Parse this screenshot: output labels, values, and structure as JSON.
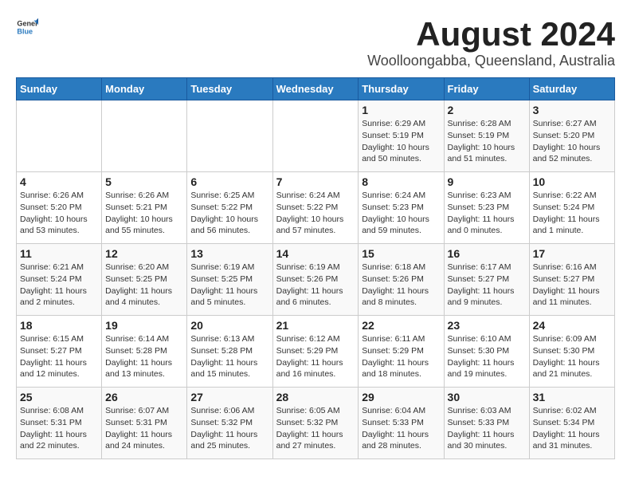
{
  "header": {
    "logo": {
      "general": "General",
      "blue": "Blue"
    },
    "title": "August 2024",
    "subtitle": "Woolloongabba, Queensland, Australia"
  },
  "calendar": {
    "days_of_week": [
      "Sunday",
      "Monday",
      "Tuesday",
      "Wednesday",
      "Thursday",
      "Friday",
      "Saturday"
    ],
    "weeks": [
      [
        {
          "day": "",
          "info": ""
        },
        {
          "day": "",
          "info": ""
        },
        {
          "day": "",
          "info": ""
        },
        {
          "day": "",
          "info": ""
        },
        {
          "day": "1",
          "info": "Sunrise: 6:29 AM\nSunset: 5:19 PM\nDaylight: 10 hours and 50 minutes."
        },
        {
          "day": "2",
          "info": "Sunrise: 6:28 AM\nSunset: 5:19 PM\nDaylight: 10 hours and 51 minutes."
        },
        {
          "day": "3",
          "info": "Sunrise: 6:27 AM\nSunset: 5:20 PM\nDaylight: 10 hours and 52 minutes."
        }
      ],
      [
        {
          "day": "4",
          "info": "Sunrise: 6:26 AM\nSunset: 5:20 PM\nDaylight: 10 hours and 53 minutes."
        },
        {
          "day": "5",
          "info": "Sunrise: 6:26 AM\nSunset: 5:21 PM\nDaylight: 10 hours and 55 minutes."
        },
        {
          "day": "6",
          "info": "Sunrise: 6:25 AM\nSunset: 5:22 PM\nDaylight: 10 hours and 56 minutes."
        },
        {
          "day": "7",
          "info": "Sunrise: 6:24 AM\nSunset: 5:22 PM\nDaylight: 10 hours and 57 minutes."
        },
        {
          "day": "8",
          "info": "Sunrise: 6:24 AM\nSunset: 5:23 PM\nDaylight: 10 hours and 59 minutes."
        },
        {
          "day": "9",
          "info": "Sunrise: 6:23 AM\nSunset: 5:23 PM\nDaylight: 11 hours and 0 minutes."
        },
        {
          "day": "10",
          "info": "Sunrise: 6:22 AM\nSunset: 5:24 PM\nDaylight: 11 hours and 1 minute."
        }
      ],
      [
        {
          "day": "11",
          "info": "Sunrise: 6:21 AM\nSunset: 5:24 PM\nDaylight: 11 hours and 2 minutes."
        },
        {
          "day": "12",
          "info": "Sunrise: 6:20 AM\nSunset: 5:25 PM\nDaylight: 11 hours and 4 minutes."
        },
        {
          "day": "13",
          "info": "Sunrise: 6:19 AM\nSunset: 5:25 PM\nDaylight: 11 hours and 5 minutes."
        },
        {
          "day": "14",
          "info": "Sunrise: 6:19 AM\nSunset: 5:26 PM\nDaylight: 11 hours and 6 minutes."
        },
        {
          "day": "15",
          "info": "Sunrise: 6:18 AM\nSunset: 5:26 PM\nDaylight: 11 hours and 8 minutes."
        },
        {
          "day": "16",
          "info": "Sunrise: 6:17 AM\nSunset: 5:27 PM\nDaylight: 11 hours and 9 minutes."
        },
        {
          "day": "17",
          "info": "Sunrise: 6:16 AM\nSunset: 5:27 PM\nDaylight: 11 hours and 11 minutes."
        }
      ],
      [
        {
          "day": "18",
          "info": "Sunrise: 6:15 AM\nSunset: 5:27 PM\nDaylight: 11 hours and 12 minutes."
        },
        {
          "day": "19",
          "info": "Sunrise: 6:14 AM\nSunset: 5:28 PM\nDaylight: 11 hours and 13 minutes."
        },
        {
          "day": "20",
          "info": "Sunrise: 6:13 AM\nSunset: 5:28 PM\nDaylight: 11 hours and 15 minutes."
        },
        {
          "day": "21",
          "info": "Sunrise: 6:12 AM\nSunset: 5:29 PM\nDaylight: 11 hours and 16 minutes."
        },
        {
          "day": "22",
          "info": "Sunrise: 6:11 AM\nSunset: 5:29 PM\nDaylight: 11 hours and 18 minutes."
        },
        {
          "day": "23",
          "info": "Sunrise: 6:10 AM\nSunset: 5:30 PM\nDaylight: 11 hours and 19 minutes."
        },
        {
          "day": "24",
          "info": "Sunrise: 6:09 AM\nSunset: 5:30 PM\nDaylight: 11 hours and 21 minutes."
        }
      ],
      [
        {
          "day": "25",
          "info": "Sunrise: 6:08 AM\nSunset: 5:31 PM\nDaylight: 11 hours and 22 minutes."
        },
        {
          "day": "26",
          "info": "Sunrise: 6:07 AM\nSunset: 5:31 PM\nDaylight: 11 hours and 24 minutes."
        },
        {
          "day": "27",
          "info": "Sunrise: 6:06 AM\nSunset: 5:32 PM\nDaylight: 11 hours and 25 minutes."
        },
        {
          "day": "28",
          "info": "Sunrise: 6:05 AM\nSunset: 5:32 PM\nDaylight: 11 hours and 27 minutes."
        },
        {
          "day": "29",
          "info": "Sunrise: 6:04 AM\nSunset: 5:33 PM\nDaylight: 11 hours and 28 minutes."
        },
        {
          "day": "30",
          "info": "Sunrise: 6:03 AM\nSunset: 5:33 PM\nDaylight: 11 hours and 30 minutes."
        },
        {
          "day": "31",
          "info": "Sunrise: 6:02 AM\nSunset: 5:34 PM\nDaylight: 11 hours and 31 minutes."
        }
      ]
    ]
  }
}
